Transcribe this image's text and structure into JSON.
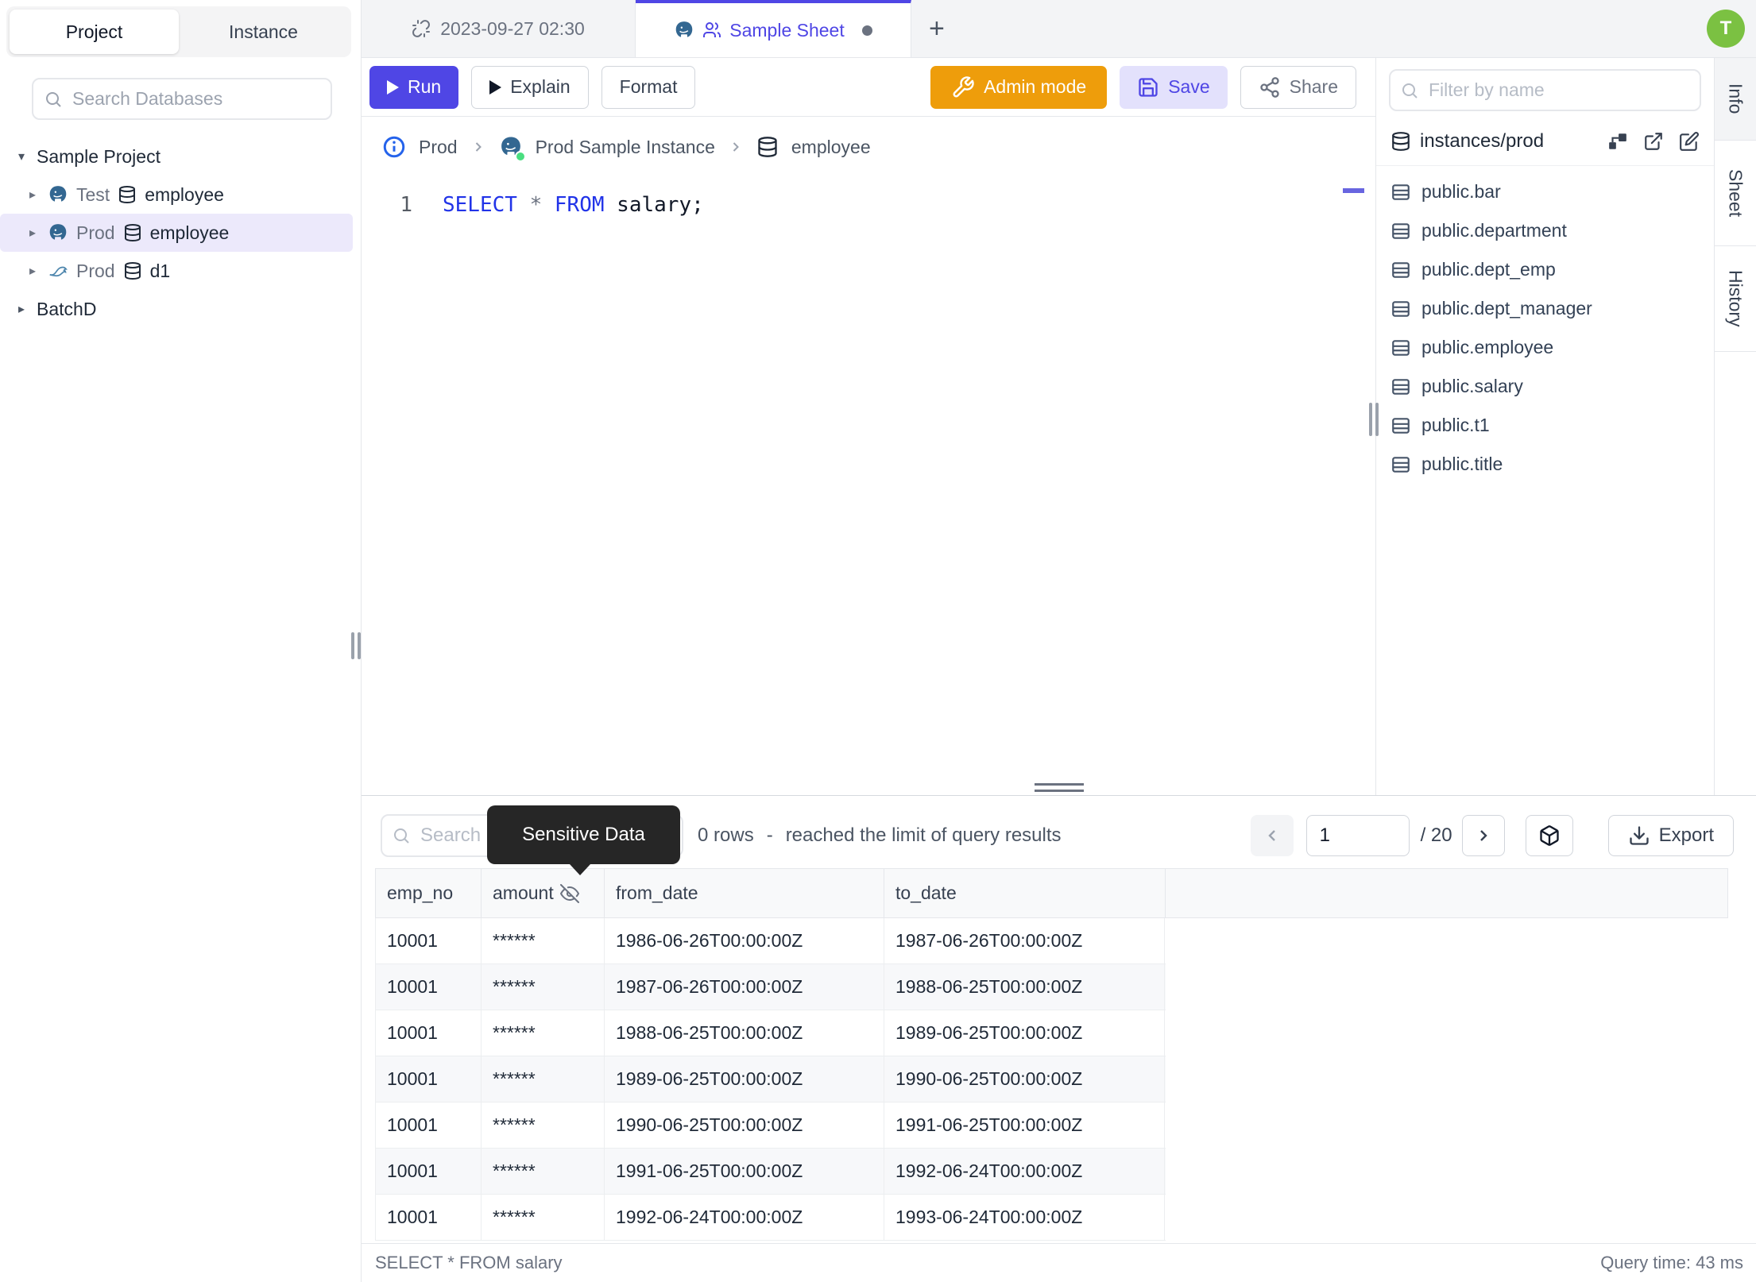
{
  "app": {
    "avatar_initial": "T"
  },
  "icons": {
    "caret_down": "▾",
    "caret_right": "▸",
    "plus": "+"
  },
  "left_sidebar": {
    "tabs": [
      {
        "label": "Project"
      },
      {
        "label": "Instance"
      }
    ],
    "search_placeholder": "Search Databases",
    "project_root": "Sample Project",
    "connections": [
      {
        "environment": "Test",
        "database": "employee",
        "engine": "postgresql"
      },
      {
        "environment": "Prod",
        "database": "employee",
        "engine": "postgresql"
      },
      {
        "environment": "Prod",
        "database": "d1",
        "engine": "mysql"
      }
    ],
    "project_collapsed": "BatchD"
  },
  "tab_bar": {
    "sheet_tabs": [
      {
        "label": "2023-09-27 02:30"
      },
      {
        "label": "Sample Sheet"
      }
    ]
  },
  "toolbar": {
    "run_label": "Run",
    "explain_label": "Explain",
    "format_label": "Format",
    "admin_mode_label": "Admin mode",
    "save_label": "Save",
    "share_label": "Share"
  },
  "breadcrumb": {
    "environment": "Prod",
    "instance": "Prod Sample Instance",
    "database": "employee"
  },
  "editor": {
    "line_number": "1",
    "sql": {
      "select": "SELECT",
      "star": "*",
      "from": "FROM",
      "rest": "salary;"
    }
  },
  "schema_panel": {
    "filter_placeholder": "Filter by name",
    "connection_label": "instances/prod",
    "tables": [
      "public.bar",
      "public.department",
      "public.dept_emp",
      "public.dept_manager",
      "public.employee",
      "public.salary",
      "public.t1",
      "public.title"
    ]
  },
  "side_tabs": [
    {
      "label": "Info"
    },
    {
      "label": "Sheet"
    },
    {
      "label": "History"
    }
  ],
  "results": {
    "search_placeholder": "Search",
    "tooltip_label": "Sensitive Data",
    "rows_count": "0 rows",
    "summary_separator": "-",
    "limit_message": "reached the limit of query results",
    "page_current": "1",
    "page_total": "/ 20",
    "export_label": "Export",
    "columns": [
      "emp_no",
      "amount",
      "from_date",
      "to_date"
    ],
    "rows": [
      [
        "10001",
        "******",
        "1986-06-26T00:00:00Z",
        "1987-06-26T00:00:00Z"
      ],
      [
        "10001",
        "******",
        "1987-06-26T00:00:00Z",
        "1988-06-25T00:00:00Z"
      ],
      [
        "10001",
        "******",
        "1988-06-25T00:00:00Z",
        "1989-06-25T00:00:00Z"
      ],
      [
        "10001",
        "******",
        "1989-06-25T00:00:00Z",
        "1990-06-25T00:00:00Z"
      ],
      [
        "10001",
        "******",
        "1990-06-25T00:00:00Z",
        "1991-06-25T00:00:00Z"
      ],
      [
        "10001",
        "******",
        "1991-06-25T00:00:00Z",
        "1992-06-24T00:00:00Z"
      ],
      [
        "10001",
        "******",
        "1992-06-24T00:00:00Z",
        "1993-06-24T00:00:00Z"
      ]
    ]
  },
  "status_bar": {
    "statement": "SELECT * FROM salary",
    "query_time": "Query time: 43 ms"
  },
  "colors": {
    "accent_indigo": "#4f46e5",
    "admin_orange": "#ee9d0b",
    "avatar_green": "#7bc142",
    "selected_tree_bg": "#ece9fb",
    "sql_keyword_blue": "#2133e8",
    "tooltip_bg": "#262626",
    "status_dot_green": "#4ade80"
  }
}
